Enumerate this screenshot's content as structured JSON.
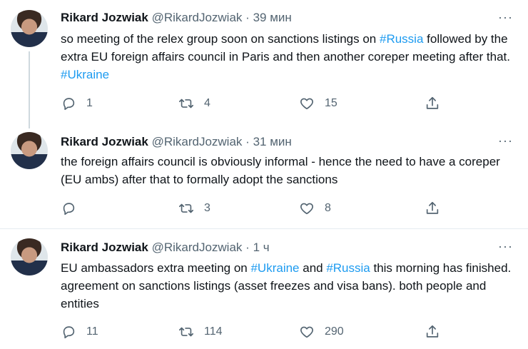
{
  "tweets": [
    {
      "name": "Rikard Jozwiak",
      "handle": "@RikardJozwiak",
      "separator": "·",
      "time": "39 мин",
      "text": {
        "p1": "so meeting of the relex group soon on sanctions listings on ",
        "h1": "#Russia",
        "p2": " followed by the extra EU foreign affairs council in Paris and then another coreper meeting after that. ",
        "h2": "#Ukraine"
      },
      "replies": "1",
      "retweets": "4",
      "likes": "15"
    },
    {
      "name": "Rikard Jozwiak",
      "handle": "@RikardJozwiak",
      "separator": "·",
      "time": "31 мин",
      "text": {
        "p1": "the foreign affairs council is obviously informal - hence the need to have a coreper (EU ambs) after that to formally adopt the sanctions"
      },
      "replies": "",
      "retweets": "3",
      "likes": "8"
    },
    {
      "name": "Rikard Jozwiak",
      "handle": "@RikardJozwiak",
      "separator": "·",
      "time": "1 ч",
      "text": {
        "p1": "EU ambassadors extra meeting on ",
        "h1": "#Ukraine",
        "p2": " and ",
        "h2": "#Russia",
        "p3": " this morning has finished. agreement on sanctions listings (asset freezes and visa bans). both people and entities"
      },
      "replies": "11",
      "retweets": "114",
      "likes": "290"
    }
  ],
  "icons": {
    "reply": "reply-icon",
    "retweet": "retweet-icon",
    "like": "heart-icon",
    "share": "share-icon",
    "more": "more-dots-icon"
  },
  "colors": {
    "hashtag": "#1d9bf0",
    "secondary_text": "#536471",
    "primary_text": "#0f1419"
  }
}
